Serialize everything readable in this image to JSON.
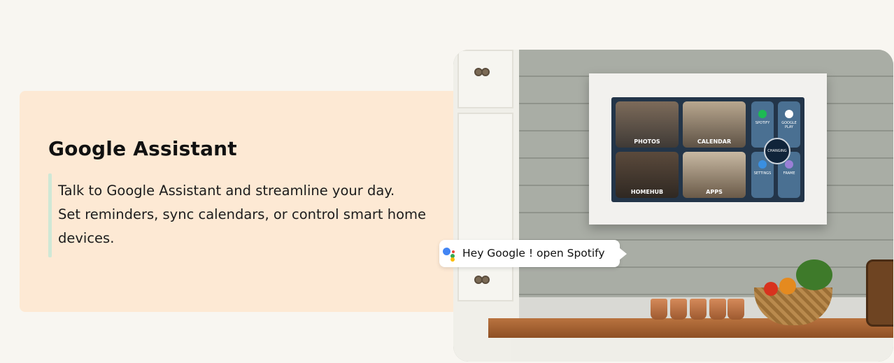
{
  "feature": {
    "title": "Google Assistant",
    "description_lines": [
      "Talk to Google Assistant and streamline your day.",
      "Set reminders, sync calendars, or control smart home",
      "devices."
    ],
    "accent_color": "#cfe8d6",
    "panel_color": "#fde9d4"
  },
  "voice_bubble": {
    "text": "Hey Google ! open Spotify",
    "icon": "google-assistant-icon"
  },
  "screen_tiles": {
    "photos": "PHOTOS",
    "calendar": "CALENDAR",
    "homehub": "HOMEHUB",
    "apps": "APPS",
    "spotify": "SPOTIFY",
    "google_play": "GOOGLE PLAY",
    "settings": "SETTINGS",
    "frame": "FRAME",
    "badge": "CHANGING"
  }
}
